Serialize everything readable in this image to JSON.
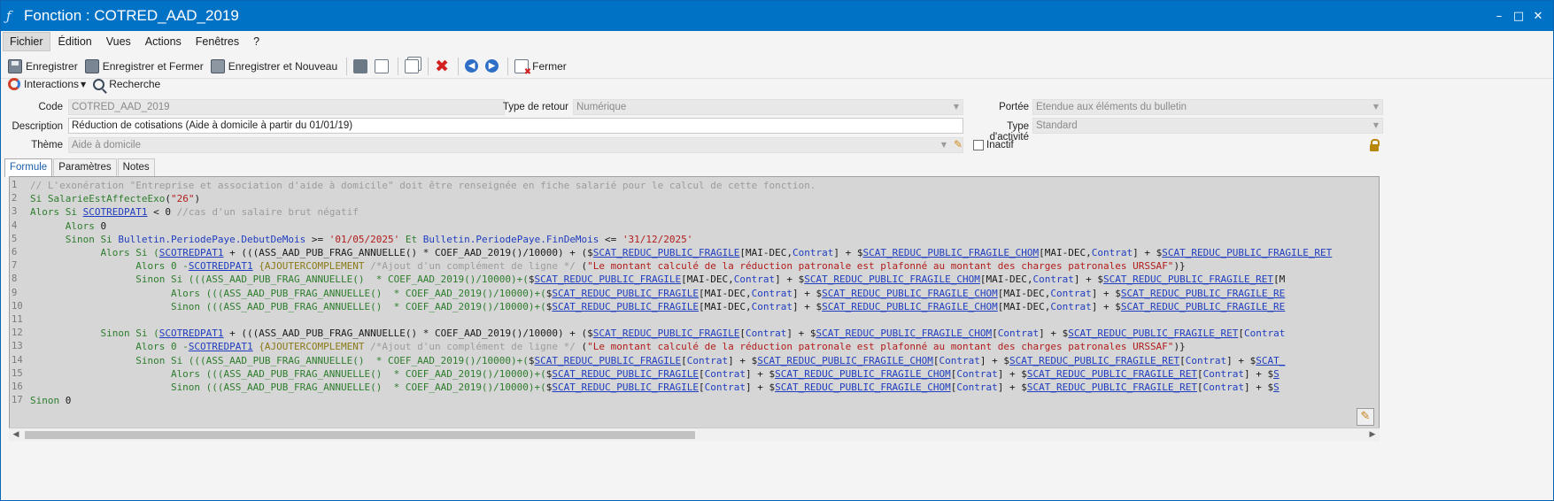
{
  "window": {
    "title": "Fonction : COTRED_AAD_2019",
    "app_icon": "function-icon",
    "controls": {
      "minimize": "–",
      "restore": "□",
      "close": "✕"
    }
  },
  "menu": [
    "Fichier",
    "Édition",
    "Vues",
    "Actions",
    "Fenêtres",
    "?"
  ],
  "toolbar": {
    "save": "Enregistrer",
    "save_close": "Enregistrer et Fermer",
    "save_new": "Enregistrer et Nouveau",
    "close": "Fermer"
  },
  "toolbar2": {
    "interactions": "Interactions",
    "search": "Recherche"
  },
  "form": {
    "code_label": "Code",
    "code_value": "COTRED_AAD_2019",
    "return_type_label": "Type de retour",
    "return_type_value": "Numérique",
    "scope_label": "Portée",
    "scope_value": "Etendue aux éléments du bulletin",
    "description_label": "Description",
    "description_value": "Réduction de cotisations (Aide à domicile à partir du 01/01/19)",
    "activity_type_label": "Type d'activité",
    "activity_type_value": "Standard",
    "theme_label": "Thème",
    "theme_value": "Aide à domicile",
    "inactive_label": "Inactif"
  },
  "tabs": [
    "Formule",
    "Paramètres",
    "Notes"
  ],
  "code_lines": [
    [
      {
        "t": "// L'exonération \"Entreprise et association d'aide à domicile\" doit être renseignée en fiche salarié pour le calcul de cette fonction.",
        "c": "com"
      }
    ],
    [
      {
        "t": "Si ",
        "c": "kw"
      },
      {
        "t": "SalarieEstAffecteExo",
        "c": "kw"
      },
      {
        "t": "(",
        "c": "op"
      },
      {
        "t": "\"26\"",
        "c": "str"
      },
      {
        "t": ")",
        "c": "op"
      }
    ],
    [
      {
        "t": "Alors Si ",
        "c": "kw"
      },
      {
        "t": "SCOTREDPAT1",
        "c": "var"
      },
      {
        "t": " < 0 ",
        "c": "op"
      },
      {
        "t": "//cas d'un salaire brut négatif",
        "c": "com"
      }
    ],
    [
      {
        "t": "      Alors ",
        "c": "kw"
      },
      {
        "t": "0",
        "c": "num"
      }
    ],
    [
      {
        "t": "      Sinon Si ",
        "c": "kw"
      },
      {
        "t": "Bulletin.PeriodePaye.DebutDeMois",
        "c": "prop"
      },
      {
        "t": " >= ",
        "c": "op"
      },
      {
        "t": "'01/05/2025'",
        "c": "str"
      },
      {
        "t": " Et ",
        "c": "kw"
      },
      {
        "t": "Bulletin.PeriodePaye.FinDeMois",
        "c": "prop"
      },
      {
        "t": " <= ",
        "c": "op"
      },
      {
        "t": "'31/12/2025'",
        "c": "str"
      }
    ],
    [
      {
        "t": "            Alors Si (",
        "c": "kw"
      },
      {
        "t": "SCOTREDPAT1",
        "c": "var"
      },
      {
        "t": " + (((ASS_AAD_PUB_FRAG_ANNUELLE() * COEF_AAD_2019()/10000) + (",
        "c": "op"
      },
      {
        "t": "$",
        "c": "op"
      },
      {
        "t": "SCAT_REDUC_PUBLIC_FRAGILE",
        "c": "var"
      },
      {
        "t": "[MAI-DEC,",
        "c": "op"
      },
      {
        "t": "Contrat",
        "c": "prop"
      },
      {
        "t": "] + $",
        "c": "op"
      },
      {
        "t": "SCAT_REDUC_PUBLIC_FRAGILE_CHOM",
        "c": "var"
      },
      {
        "t": "[MAI-DEC,",
        "c": "op"
      },
      {
        "t": "Contrat",
        "c": "prop"
      },
      {
        "t": "] + $",
        "c": "op"
      },
      {
        "t": "SCAT_REDUC_PUBLIC_FRAGILE_RET",
        "c": "var"
      }
    ],
    [
      {
        "t": "                  Alors 0 -",
        "c": "kw"
      },
      {
        "t": "SCOTREDPAT1",
        "c": "var"
      },
      {
        "t": " {AJOUTERCOMPLEMENT ",
        "c": "cmd"
      },
      {
        "t": "/*Ajout d'un complément de ligne */",
        "c": "com"
      },
      {
        "t": " (",
        "c": "op"
      },
      {
        "t": "\"Le montant calculé de la réduction patronale est plafonné au montant des charges patronales URSSAF\"",
        "c": "str"
      },
      {
        "t": ")}",
        "c": "op"
      }
    ],
    [
      {
        "t": "                  Sinon Si (((ASS_AAD_PUB_FRAG_ANNUELLE()  * COEF_AAD_2019()/10000)+(",
        "c": "kw"
      },
      {
        "t": "$",
        "c": "op"
      },
      {
        "t": "SCAT_REDUC_PUBLIC_FRAGILE",
        "c": "var"
      },
      {
        "t": "[MAI-DEC,",
        "c": "op"
      },
      {
        "t": "Contrat",
        "c": "prop"
      },
      {
        "t": "] + $",
        "c": "op"
      },
      {
        "t": "SCAT_REDUC_PUBLIC_FRAGILE_CHOM",
        "c": "var"
      },
      {
        "t": "[MAI-DEC,",
        "c": "op"
      },
      {
        "t": "Contrat",
        "c": "prop"
      },
      {
        "t": "] + $",
        "c": "op"
      },
      {
        "t": "SCAT_REDUC_PUBLIC_FRAGILE_RET",
        "c": "var"
      },
      {
        "t": "[M",
        "c": "op"
      }
    ],
    [
      {
        "t": "                        Alors (((ASS_AAD_PUB_FRAG_ANNUELLE()  * COEF_AAD_2019()/10000)+(",
        "c": "kw"
      },
      {
        "t": "$",
        "c": "op"
      },
      {
        "t": "SCAT_REDUC_PUBLIC_FRAGILE",
        "c": "var"
      },
      {
        "t": "[MAI-DEC,",
        "c": "op"
      },
      {
        "t": "Contrat",
        "c": "prop"
      },
      {
        "t": "] + $",
        "c": "op"
      },
      {
        "t": "SCAT_REDUC_PUBLIC_FRAGILE_CHOM",
        "c": "var"
      },
      {
        "t": "[MAI-DEC,",
        "c": "op"
      },
      {
        "t": "Contrat",
        "c": "prop"
      },
      {
        "t": "] + $",
        "c": "op"
      },
      {
        "t": "SCAT_REDUC_PUBLIC_FRAGILE_RE",
        "c": "var"
      }
    ],
    [
      {
        "t": "                        Sinon (((ASS_AAD_PUB_FRAG_ANNUELLE()  * COEF_AAD_2019()/10000)+(",
        "c": "kw"
      },
      {
        "t": "$",
        "c": "op"
      },
      {
        "t": "SCAT_REDUC_PUBLIC_FRAGILE",
        "c": "var"
      },
      {
        "t": "[MAI-DEC,",
        "c": "op"
      },
      {
        "t": "Contrat",
        "c": "prop"
      },
      {
        "t": "] + $",
        "c": "op"
      },
      {
        "t": "SCAT_REDUC_PUBLIC_FRAGILE_CHOM",
        "c": "var"
      },
      {
        "t": "[MAI-DEC,",
        "c": "op"
      },
      {
        "t": "Contrat",
        "c": "prop"
      },
      {
        "t": "] + $",
        "c": "op"
      },
      {
        "t": "SCAT_REDUC_PUBLIC_FRAGILE_RE",
        "c": "var"
      }
    ],
    [
      {
        "t": "",
        "c": "op"
      }
    ],
    [
      {
        "t": "            Sinon Si (",
        "c": "kw"
      },
      {
        "t": "SCOTREDPAT1",
        "c": "var"
      },
      {
        "t": " + (((ASS_AAD_PUB_FRAG_ANNUELLE() * COEF_AAD_2019()/10000) + (",
        "c": "op"
      },
      {
        "t": "$",
        "c": "op"
      },
      {
        "t": "SCAT_REDUC_PUBLIC_FRAGILE",
        "c": "var"
      },
      {
        "t": "[",
        "c": "op"
      },
      {
        "t": "Contrat",
        "c": "prop"
      },
      {
        "t": "] + $",
        "c": "op"
      },
      {
        "t": "SCAT_REDUC_PUBLIC_FRAGILE_CHOM",
        "c": "var"
      },
      {
        "t": "[",
        "c": "op"
      },
      {
        "t": "Contrat",
        "c": "prop"
      },
      {
        "t": "] + $",
        "c": "op"
      },
      {
        "t": "SCAT_REDUC_PUBLIC_FRAGILE_RET",
        "c": "var"
      },
      {
        "t": "[",
        "c": "op"
      },
      {
        "t": "Contrat",
        "c": "prop"
      }
    ],
    [
      {
        "t": "                  Alors 0 -",
        "c": "kw"
      },
      {
        "t": "SCOTREDPAT1",
        "c": "var"
      },
      {
        "t": " {AJOUTERCOMPLEMENT ",
        "c": "cmd"
      },
      {
        "t": "/*Ajout d'un complément de ligne */",
        "c": "com"
      },
      {
        "t": " (",
        "c": "op"
      },
      {
        "t": "\"Le montant calculé de la réduction patronale est plafonné au montant des charges patronales URSSAF\"",
        "c": "str"
      },
      {
        "t": ")}",
        "c": "op"
      }
    ],
    [
      {
        "t": "                  Sinon Si (((ASS_AAD_PUB_FRAG_ANNUELLE()  * COEF_AAD_2019()/10000)+(",
        "c": "kw"
      },
      {
        "t": "$",
        "c": "op"
      },
      {
        "t": "SCAT_REDUC_PUBLIC_FRAGILE",
        "c": "var"
      },
      {
        "t": "[",
        "c": "op"
      },
      {
        "t": "Contrat",
        "c": "prop"
      },
      {
        "t": "] + $",
        "c": "op"
      },
      {
        "t": "SCAT_REDUC_PUBLIC_FRAGILE_CHOM",
        "c": "var"
      },
      {
        "t": "[",
        "c": "op"
      },
      {
        "t": "Contrat",
        "c": "prop"
      },
      {
        "t": "] + $",
        "c": "op"
      },
      {
        "t": "SCAT_REDUC_PUBLIC_FRAGILE_RET",
        "c": "var"
      },
      {
        "t": "[",
        "c": "op"
      },
      {
        "t": "Contrat",
        "c": "prop"
      },
      {
        "t": "] + $",
        "c": "op"
      },
      {
        "t": "SCAT_",
        "c": "var"
      }
    ],
    [
      {
        "t": "                        Alors (((ASS_AAD_PUB_FRAG_ANNUELLE()  * COEF_AAD_2019()/10000)+(",
        "c": "kw"
      },
      {
        "t": "$",
        "c": "op"
      },
      {
        "t": "SCAT_REDUC_PUBLIC_FRAGILE",
        "c": "var"
      },
      {
        "t": "[",
        "c": "op"
      },
      {
        "t": "Contrat",
        "c": "prop"
      },
      {
        "t": "] + $",
        "c": "op"
      },
      {
        "t": "SCAT_REDUC_PUBLIC_FRAGILE_CHOM",
        "c": "var"
      },
      {
        "t": "[",
        "c": "op"
      },
      {
        "t": "Contrat",
        "c": "prop"
      },
      {
        "t": "] + $",
        "c": "op"
      },
      {
        "t": "SCAT_REDUC_PUBLIC_FRAGILE_RET",
        "c": "var"
      },
      {
        "t": "[",
        "c": "op"
      },
      {
        "t": "Contrat",
        "c": "prop"
      },
      {
        "t": "] + $",
        "c": "op"
      },
      {
        "t": "S",
        "c": "var"
      }
    ],
    [
      {
        "t": "                        Sinon (((ASS_AAD_PUB_FRAG_ANNUELLE()  * COEF_AAD_2019()/10000)+(",
        "c": "kw"
      },
      {
        "t": "$",
        "c": "op"
      },
      {
        "t": "SCAT_REDUC_PUBLIC_FRAGILE",
        "c": "var"
      },
      {
        "t": "[",
        "c": "op"
      },
      {
        "t": "Contrat",
        "c": "prop"
      },
      {
        "t": "] + $",
        "c": "op"
      },
      {
        "t": "SCAT_REDUC_PUBLIC_FRAGILE_CHOM",
        "c": "var"
      },
      {
        "t": "[",
        "c": "op"
      },
      {
        "t": "Contrat",
        "c": "prop"
      },
      {
        "t": "] + $",
        "c": "op"
      },
      {
        "t": "SCAT_REDUC_PUBLIC_FRAGILE_RET",
        "c": "var"
      },
      {
        "t": "[",
        "c": "op"
      },
      {
        "t": "Contrat",
        "c": "prop"
      },
      {
        "t": "] + $",
        "c": "op"
      },
      {
        "t": "S",
        "c": "var"
      }
    ],
    [
      {
        "t": "Sinon ",
        "c": "kw"
      },
      {
        "t": "0",
        "c": "num"
      }
    ]
  ]
}
